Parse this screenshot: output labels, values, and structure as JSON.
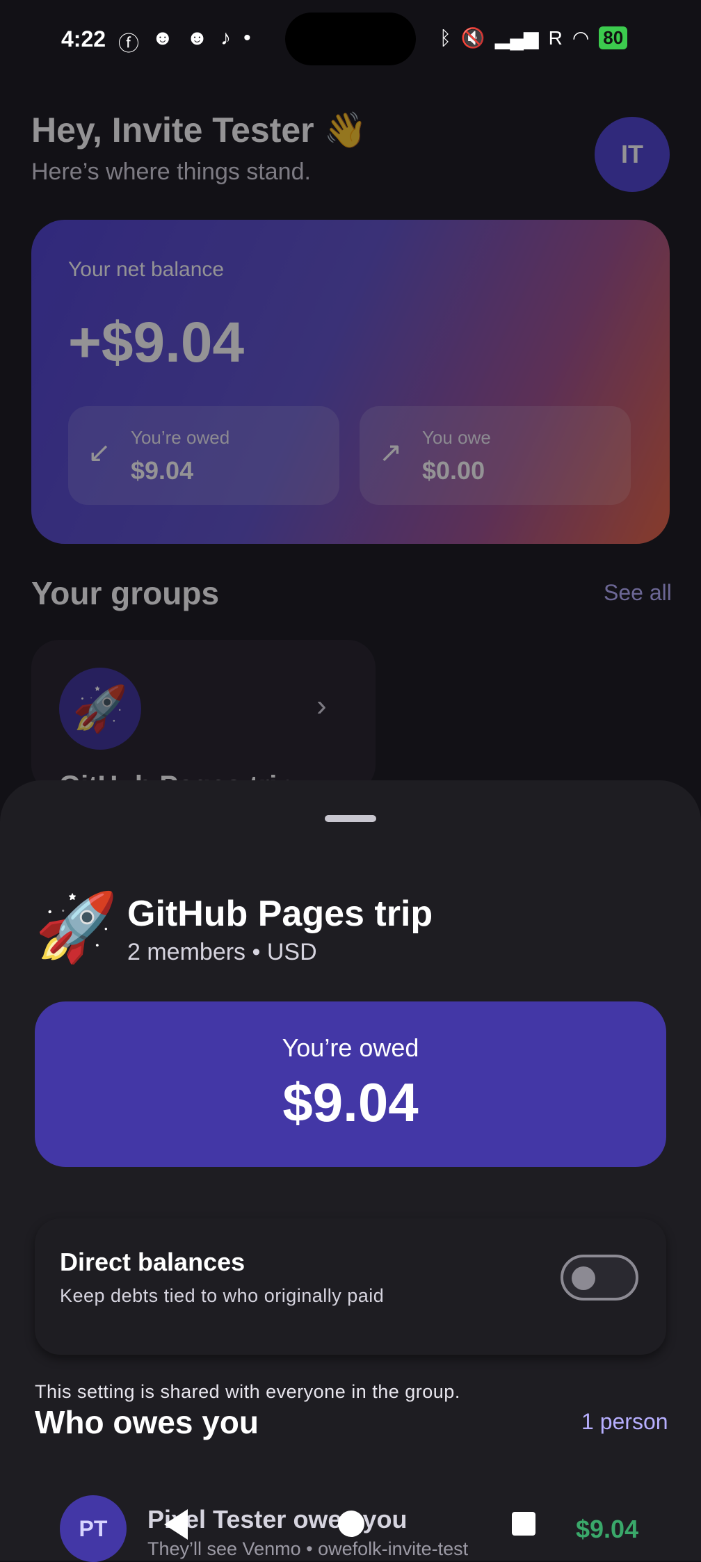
{
  "status_bar": {
    "time": "4:22",
    "battery": "80",
    "carrier_mark": "R"
  },
  "header": {
    "greeting": "Hey, Invite Tester 👋",
    "subtitle": "Here’s where things stand.",
    "avatar_initials": "IT"
  },
  "net_balance": {
    "label": "Your net balance",
    "value": "+$9.04",
    "owed_label": "You’re owed",
    "owed_value": "$9.04",
    "owe_label": "You owe",
    "owe_value": "$0.00"
  },
  "groups": {
    "title": "Your groups",
    "see_all": "See all",
    "cards": [
      {
        "emoji": "🚀",
        "name_partial": "GitHub Pages trip"
      }
    ]
  },
  "sheet": {
    "emoji": "🚀",
    "title": "GitHub Pages trip",
    "subtitle": "2 members • USD",
    "owed_label": "You’re owed",
    "owed_value": "$9.04",
    "direct_title": "Direct balances",
    "direct_sub": "Keep debts tied to who originally paid",
    "direct_enabled": false,
    "shared_note": "This setting is shared with everyone in the group.",
    "owes_title": "Who owes you",
    "owes_count": "1 person",
    "rows": [
      {
        "initials": "PT",
        "title": "Pixel Tester owes you",
        "subtitle": "They’ll see Venmo • owefolk-invite-test",
        "amount": "$9.04"
      }
    ]
  },
  "colors": {
    "accent": "#4337a6",
    "link": "#b7afff",
    "positive": "#3aa86a"
  }
}
